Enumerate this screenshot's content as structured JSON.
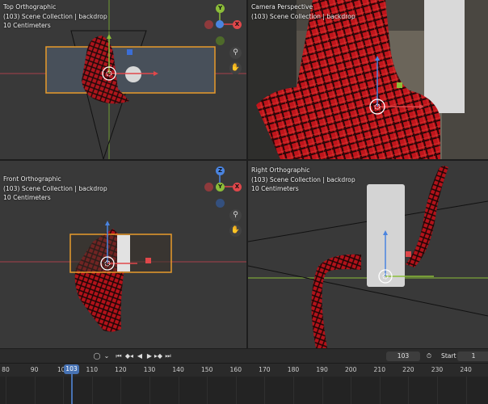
{
  "viewports": {
    "top_left": {
      "name": "Top Orthographic",
      "collection": "(103) Scene Collection | backdrop",
      "units": "10 Centimeters"
    },
    "top_right": {
      "name": "Camera Perspective",
      "collection": "(103) Scene Collection | backdrop"
    },
    "bottom_left": {
      "name": "Front Orthographic",
      "collection": "(103) Scene Collection | backdrop",
      "units": "10 Centimeters"
    },
    "bottom_right": {
      "name": "Right Orthographic",
      "collection": "(103) Scene Collection | backdrop",
      "units": "10 Centimeters"
    }
  },
  "gizmo_labels": {
    "y": "Y",
    "x": "X",
    "z": "Z"
  },
  "icons": {
    "zoom": "zoom-icon",
    "pan": "hand-icon"
  },
  "colors": {
    "x_axis": "#e0474a",
    "y_axis": "#8cbe39",
    "z_axis": "#4a84e0",
    "plaid": "#c4141c",
    "selection": "#e89a2a"
  },
  "timeline": {
    "current_frame": "103",
    "start_label": "Start",
    "start_value": "1",
    "ruler": [
      "80",
      "90",
      "100",
      "110",
      "120",
      "130",
      "140",
      "150",
      "160",
      "170",
      "180",
      "190",
      "200",
      "210",
      "220",
      "230",
      "240"
    ]
  }
}
